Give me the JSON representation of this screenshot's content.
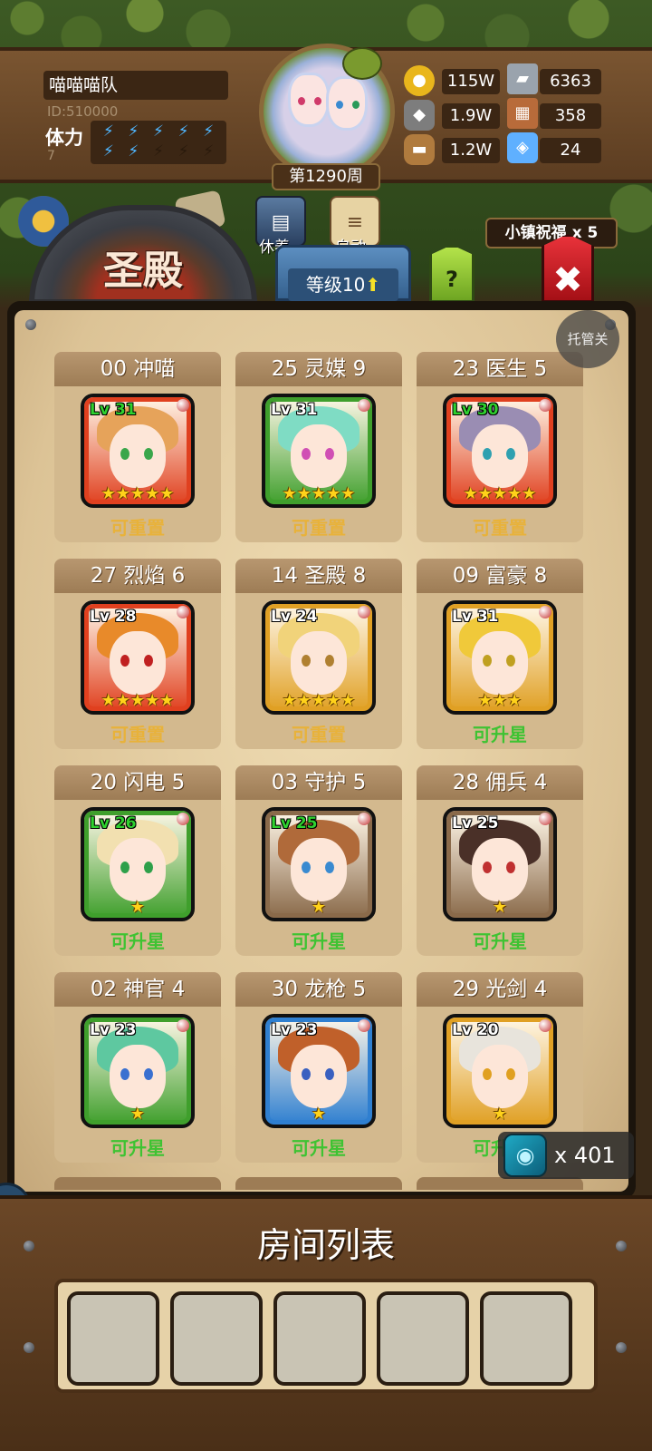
{
  "player": {
    "name": "喵喵喵队",
    "id": "ID:510000",
    "stamina_label": "体力",
    "stamina_value": "7",
    "stamina_total": 10,
    "stamina_filled": 7,
    "week": "第1290周"
  },
  "resources": [
    {
      "name": "gold-coin-icon",
      "value": "115W",
      "color": "#e9b61c"
    },
    {
      "name": "iron-ingot-icon",
      "value": "6363",
      "color": "#9aa3ad"
    },
    {
      "name": "stone-icon",
      "value": "1.9W",
      "color": "#7d7d7d"
    },
    {
      "name": "cloth-icon",
      "value": "358",
      "color": "#b86b3a"
    },
    {
      "name": "wood-log-icon",
      "value": "1.2W",
      "color": "#b07b3e"
    },
    {
      "name": "crystal-icon",
      "value": "24",
      "color": "#5fb0ff"
    }
  ],
  "quick_actions": {
    "rest": "休养",
    "auto": "自动"
  },
  "blessing": "小镇祝福 x 5",
  "building_title": "圣殿",
  "level_tab": "等级10",
  "help_label": "?",
  "auto_manage": "托管关",
  "heroes": [
    {
      "title": "00 冲喵",
      "lv": "Lv 31",
      "lv_color": "#2fd12f",
      "stars": "★★★★★",
      "status": "可重置",
      "status_type": "reset",
      "frame": "#e0401f",
      "hair": "#e6a35a",
      "eye": "#3aa64a"
    },
    {
      "title": "25 灵媒 9",
      "lv": "Lv 31",
      "lv_color": "#ffffff",
      "stars": "★★★★★",
      "status": "可重置",
      "status_type": "reset",
      "frame": "#3f9f2c",
      "hair": "#7fdcc4",
      "eye": "#d04fb4"
    },
    {
      "title": "23 医生 5",
      "lv": "Lv 30",
      "lv_color": "#2fd12f",
      "stars": "★★★★★",
      "status": "可重置",
      "status_type": "reset",
      "frame": "#e0401f",
      "hair": "#9a8db3",
      "eye": "#2fa0b0"
    },
    {
      "title": "27 烈焰 6",
      "lv": "Lv 28",
      "lv_color": "#ffffff",
      "stars": "★★★★★",
      "status": "可重置",
      "status_type": "reset",
      "frame": "#e0401f",
      "hair": "#e88a2a",
      "eye": "#c02020"
    },
    {
      "title": "14 圣殿 8",
      "lv": "Lv 24",
      "lv_color": "#ffffff",
      "stars": "★★★★★",
      "status": "可重置",
      "status_type": "reset",
      "frame": "#e0a024",
      "hair": "#f1d37a",
      "eye": "#b08030"
    },
    {
      "title": "09 富豪 8",
      "lv": "Lv 31",
      "lv_color": "#ffffff",
      "stars": "★★★",
      "status": "可升星",
      "status_type": "up",
      "frame": "#e0a024",
      "hair": "#f0c93a",
      "eye": "#c0a020"
    },
    {
      "title": "20 闪电 5",
      "lv": "Lv 26",
      "lv_color": "#2fd12f",
      "stars": "★",
      "status": "可升星",
      "status_type": "up",
      "frame": "#3f9f2c",
      "hair": "#f2e0b0",
      "eye": "#2ea04a"
    },
    {
      "title": "03 守护 5",
      "lv": "Lv 25",
      "lv_color": "#2fd12f",
      "stars": "★",
      "status": "可升星",
      "status_type": "up",
      "frame": "#8a6a4a",
      "hair": "#b06a3a",
      "eye": "#3a8ad0"
    },
    {
      "title": "28 佣兵 4",
      "lv": "Lv 25",
      "lv_color": "#ffffff",
      "stars": "★",
      "status": "可升星",
      "status_type": "up",
      "frame": "#8a6a4a",
      "hair": "#4a3028",
      "eye": "#c03030"
    },
    {
      "title": "02 神官 4",
      "lv": "Lv 23",
      "lv_color": "#ffffff",
      "stars": "★",
      "status": "可升星",
      "status_type": "up",
      "frame": "#3f9f2c",
      "hair": "#5ec8a0",
      "eye": "#3a70d0"
    },
    {
      "title": "30 龙枪 5",
      "lv": "Lv 23",
      "lv_color": "#ffffff",
      "stars": "★",
      "status": "可升星",
      "status_type": "up",
      "frame": "#2f7fd0",
      "hair": "#c0602a",
      "eye": "#3a60c0"
    },
    {
      "title": "29 光剑 4",
      "lv": "Lv 20",
      "lv_color": "#ffffff",
      "stars": "★",
      "status": "可升星",
      "status_type": "up",
      "frame": "#e0a024",
      "hair": "#e8e4dc",
      "eye": "#e0a020"
    }
  ],
  "token": {
    "count": "x 401"
  },
  "side_button": "up",
  "room_list_title": "房间列表",
  "room_slots": 5
}
